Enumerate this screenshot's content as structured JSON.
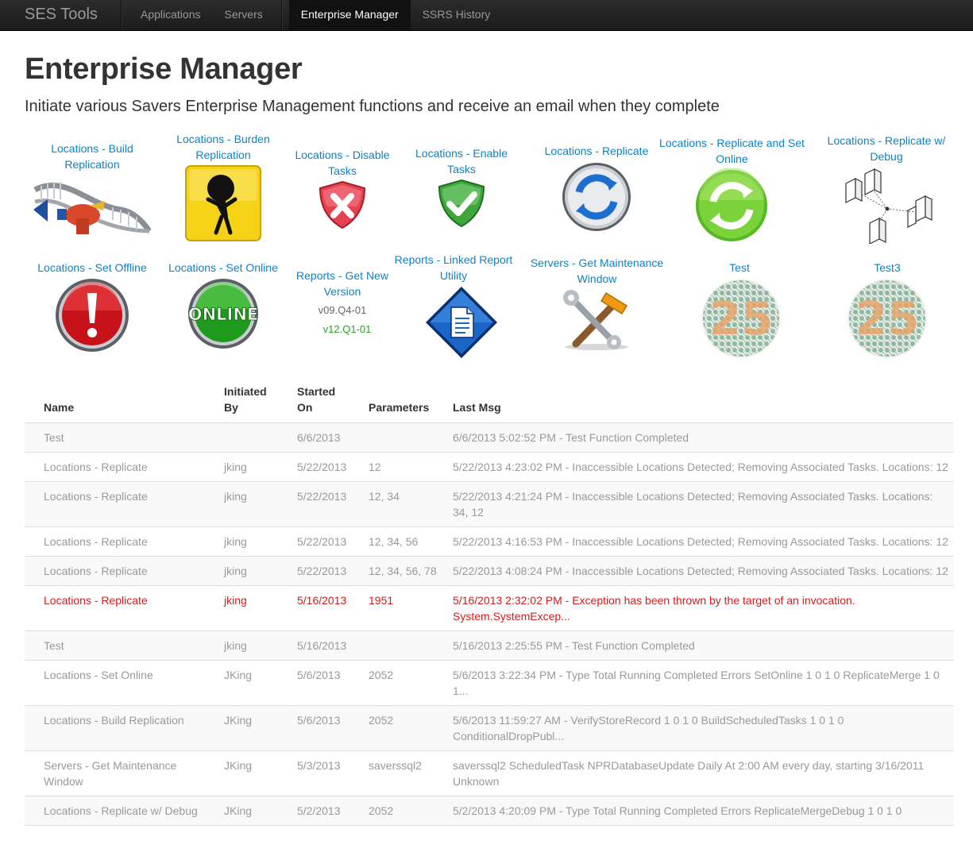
{
  "navbar": {
    "brand": "SES Tools",
    "items": [
      "Applications",
      "Servers"
    ],
    "active": "Enterprise Manager",
    "after": "SSRS History"
  },
  "page": {
    "title": "Enterprise Manager",
    "lead": "Initiate various Savers Enterprise Management functions and receive an email when they complete"
  },
  "tiles": [
    {
      "label": "Locations - Build Replication",
      "icon": "dna-helix-icon"
    },
    {
      "label": "Locations - Burden Replication",
      "icon": "burden-figure-icon"
    },
    {
      "label": "Locations - Disable Tasks",
      "icon": "red-x-shield-icon"
    },
    {
      "label": "Locations - Enable Tasks",
      "icon": "green-check-shield-icon"
    },
    {
      "label": "Locations - Replicate",
      "icon": "blue-refresh-icon"
    },
    {
      "label": "Locations - Replicate and Set Online",
      "icon": "green-refresh-icon"
    },
    {
      "label": "Locations - Replicate w/ Debug",
      "icon": "server-network-icon"
    },
    {
      "label": "Locations - Set Offline",
      "icon": "red-exclamation-icon"
    },
    {
      "label": "Locations - Set Online",
      "icon": "green-online-icon"
    },
    {
      "label": "Reports - Get New Version",
      "icon": "none",
      "version_old": "v09.Q4-01",
      "version_new": "v12.Q1-01"
    },
    {
      "label": "Reports - Linked Report Utility",
      "icon": "document-diamond-icon"
    },
    {
      "label": "Servers - Get Maintenance Window",
      "icon": "tools-icon"
    },
    {
      "label": "Test",
      "icon": "ishihara-plate-icon",
      "plate_text": "25"
    },
    {
      "label": "Test3",
      "icon": "ishihara-plate-icon",
      "plate_text": "25"
    }
  ],
  "table": {
    "headers": [
      "Name",
      "Initiated By",
      "Started On",
      "Parameters",
      "Last Msg"
    ],
    "rows": [
      {
        "name": "Test",
        "by": "",
        "on": "6/6/2013",
        "params": "",
        "msg": "6/6/2013 5:02:52 PM - Test Function Completed",
        "status": "normal"
      },
      {
        "name": "Locations - Replicate",
        "by": "jking",
        "on": "5/22/2013",
        "params": "12",
        "msg": "5/22/2013 4:23:02 PM - Inaccessible Locations Detected; Removing Associated Tasks. Locations: 12",
        "status": "normal"
      },
      {
        "name": "Locations - Replicate",
        "by": "jking",
        "on": "5/22/2013",
        "params": "12, 34",
        "msg": "5/22/2013 4:21:24 PM - Inaccessible Locations Detected; Removing Associated Tasks. Locations: 34, 12",
        "status": "normal"
      },
      {
        "name": "Locations - Replicate",
        "by": "jking",
        "on": "5/22/2013",
        "params": "12, 34, 56",
        "msg": "5/22/2013 4:16:53 PM - Inaccessible Locations Detected; Removing Associated Tasks. Locations: 12",
        "status": "normal"
      },
      {
        "name": "Locations - Replicate",
        "by": "jking",
        "on": "5/22/2013",
        "params": "12, 34, 56, 78",
        "msg": "5/22/2013 4:08:24 PM - Inaccessible Locations Detected; Removing Associated Tasks. Locations: 12",
        "status": "normal"
      },
      {
        "name": "Locations - Replicate",
        "by": "jking",
        "on": "5/16/2013",
        "params": "1951",
        "msg": "5/16/2013 2:32:02 PM - Exception has been thrown by the target of an invocation. System.SystemExcep...",
        "status": "error"
      },
      {
        "name": "Test",
        "by": "jking",
        "on": "5/16/2013",
        "params": "",
        "msg": "5/16/2013 2:25:55 PM - Test Function Completed",
        "status": "normal"
      },
      {
        "name": "Locations - Set Online",
        "by": "JKing",
        "on": "5/6/2013",
        "params": "2052",
        "msg": "5/6/2013 3:22:34 PM - Type Total Running Completed Errors SetOnline 1 0 1 0 ReplicateMerge 1 0 1...",
        "status": "normal"
      },
      {
        "name": "Locations - Build Replication",
        "by": "JKing",
        "on": "5/6/2013",
        "params": "2052",
        "msg": "5/6/2013 11:59:27 AM - VerifyStoreRecord 1 0 1 0 BuildScheduledTasks 1 0 1 0 ConditionalDropPubl...",
        "status": "normal"
      },
      {
        "name": "Servers - Get Maintenance Window",
        "by": "JKing",
        "on": "5/3/2013",
        "params": "saverssql2",
        "msg": "saverssql2 ScheduledTask NPRDatabaseUpdate Daily At 2:00 AM every day, starting 3/16/2011 Unknown",
        "status": "normal"
      },
      {
        "name": "Locations - Replicate w/ Debug",
        "by": "JKing",
        "on": "5/2/2013",
        "params": "2052",
        "msg": "5/2/2013 4:20:09 PM - Type Total Running Completed Errors ReplicateMergeDebug 1 0 1 0",
        "status": "normal"
      }
    ]
  }
}
